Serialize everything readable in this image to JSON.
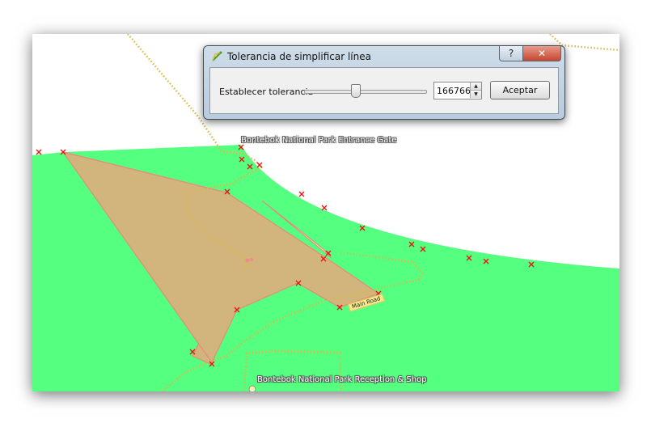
{
  "dialog": {
    "title": "Tolerancia de simplificar línea",
    "help_button": "?",
    "close_button": "✕",
    "tolerance_label": "Establecer tolerancia",
    "slider_level_fraction": 0.42,
    "tolerance_value": "166766",
    "accept_button": "Aceptar"
  },
  "map": {
    "labels": {
      "entrance_gate": "Bontebok National Park Entrance Gate",
      "reception": "Bontebok National Park Reception & Shop",
      "road": "Main Road"
    },
    "colors": {
      "park_area": "#55ff7f",
      "simplified_polygon": "#d1b57c",
      "vertex_marker": "#ee1111",
      "track": "#d9b94c"
    }
  }
}
